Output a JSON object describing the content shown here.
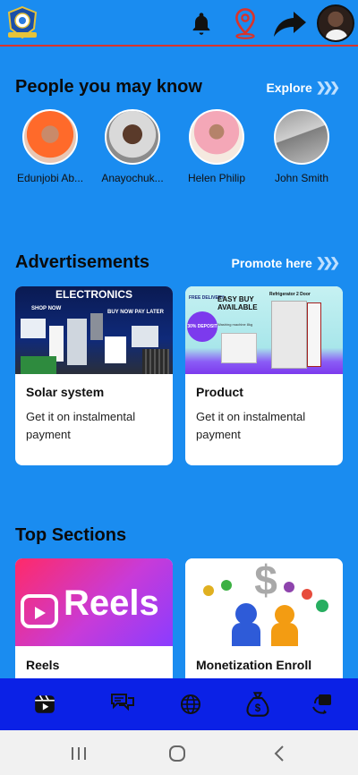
{
  "header": {
    "icons": [
      "logo-emblem",
      "bell-icon",
      "location-pin-icon",
      "share-arrow-icon",
      "profile-avatar"
    ]
  },
  "people_section": {
    "title": "People you may know",
    "link_label": "Explore",
    "people": [
      {
        "name": "Edunjobi Ab..."
      },
      {
        "name": "Anayochuk..."
      },
      {
        "name": "Helen Philip"
      },
      {
        "name": "John Smith"
      }
    ]
  },
  "ads_section": {
    "title": "Advertisements",
    "link_label": "Promote here",
    "cards": [
      {
        "title": "Solar system",
        "description": "Get it on instalmental payment",
        "banner": {
          "headline": "ELECTRONICS",
          "left_tag": "SHOP NOW",
          "right_tag": "BUY NOW PAY LATER"
        }
      },
      {
        "title": "Product",
        "description": "Get it on instalmental payment",
        "banner": {
          "tag1": "FREE DELIVERY",
          "headline": "EASY BUY AVAILABLE",
          "badge": "30% DEPOSIT",
          "label1": "Refrigerator 2 Door",
          "label2": "Washing machine 8kg"
        }
      }
    ]
  },
  "top_section": {
    "title": "Top Sections",
    "cards": [
      {
        "title": "Reels",
        "image_text": "Reels"
      },
      {
        "title": "Monetization Enroll"
      }
    ]
  },
  "bottom_nav": {
    "items": [
      "reels-icon",
      "chat-icon",
      "globe-icon",
      "money-bag-icon",
      "exchange-icon"
    ]
  },
  "system_nav": {
    "items": [
      "recent-apps",
      "home",
      "back"
    ]
  },
  "colors": {
    "background": "#1a8cf0",
    "bottom_nav": "#0b21e6",
    "header_border": "#d9342b",
    "card": "#ffffff"
  }
}
